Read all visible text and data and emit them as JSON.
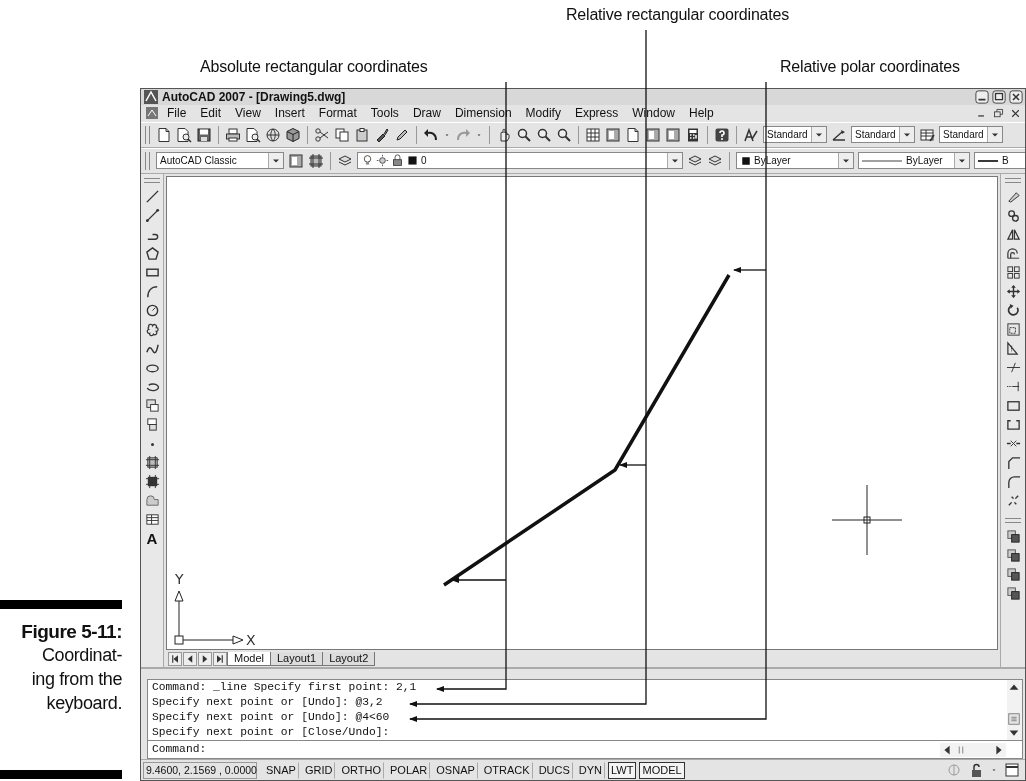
{
  "callouts": [
    {
      "label": "Absolute rectangular coordinates"
    },
    {
      "label": "Relative rectangular coordinates"
    },
    {
      "label": "Relative polar coordinates"
    }
  ],
  "caption": {
    "figure": "Figure 5-11:",
    "lines": [
      "Coordinat-",
      "ing from the",
      "keyboard."
    ]
  },
  "window": {
    "title": "AutoCAD 2007 - [Drawing5.dwg]"
  },
  "menu": [
    "File",
    "Edit",
    "View",
    "Insert",
    "Format",
    "Tools",
    "Draw",
    "Dimension",
    "Modify",
    "Express",
    "Window",
    "Help"
  ],
  "style_dropdowns": [
    {
      "value": "Standard"
    },
    {
      "value": "Standard"
    },
    {
      "value": "Standard"
    }
  ],
  "properties_toolbar": {
    "workspace": "AutoCAD Classic",
    "layer": "0",
    "color_setting": "ByLayer",
    "linetype": "ByLayer",
    "lineweight": "B"
  },
  "draw_toolbar": {
    "text_tool": "A"
  },
  "ucs": {
    "x": "X",
    "y": "Y"
  },
  "layout_tabs": [
    {
      "label": "Model",
      "selected": true
    },
    {
      "label": "Layout1",
      "selected": false
    },
    {
      "label": "Layout2",
      "selected": false
    }
  ],
  "command_history": [
    "Command: _line Specify first point: 2,1",
    "Specify next point or [Undo]: @3,2",
    "Specify next point or [Undo]: @4<60",
    "Specify next point or [Close/Undo]:"
  ],
  "command_prompt": "Command:",
  "status_bar": {
    "coordinates": "9.4600, 2.1569 , 0.0000",
    "toggles": [
      {
        "label": "SNAP",
        "on": false
      },
      {
        "label": "GRID",
        "on": false
      },
      {
        "label": "ORTHO",
        "on": false
      },
      {
        "label": "POLAR",
        "on": false
      },
      {
        "label": "OSNAP",
        "on": false
      },
      {
        "label": "OTRACK",
        "on": false
      },
      {
        "label": "DUCS",
        "on": false
      },
      {
        "label": "DYN",
        "on": false
      },
      {
        "label": "LWT",
        "on": true
      },
      {
        "label": "MODEL",
        "on": true
      }
    ]
  }
}
